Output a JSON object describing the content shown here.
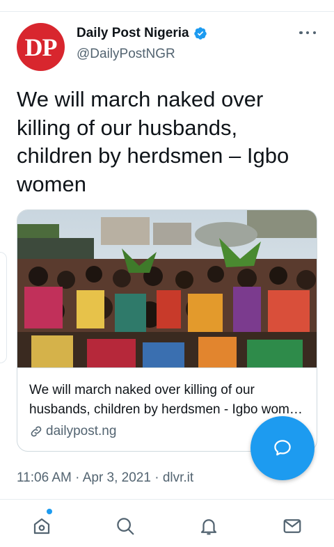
{
  "tweet": {
    "author": {
      "avatar_initials": "DP",
      "display_name": "Daily Post Nigeria",
      "handle": "@DailyPostNGR",
      "verified": true
    },
    "text": "We will march naked over killing of our husbands, children by herdsmen – Igbo women",
    "card": {
      "title": "We will march naked over killing of our husbands, children by herdsmen - Igbo women protest",
      "domain": "dailypost.ng"
    },
    "timestamp": "11:06 AM · Apr 3, 2021 · dlvr.it"
  },
  "bottom_nav": {
    "items": [
      "home-icon",
      "search-icon",
      "notifications-icon",
      "messages-icon"
    ]
  },
  "colors": {
    "accent": "#1d9bf0",
    "avatar_bg": "#d8262e",
    "text_primary": "#0f1419",
    "text_secondary": "#536471",
    "border": "#cfd9de"
  }
}
